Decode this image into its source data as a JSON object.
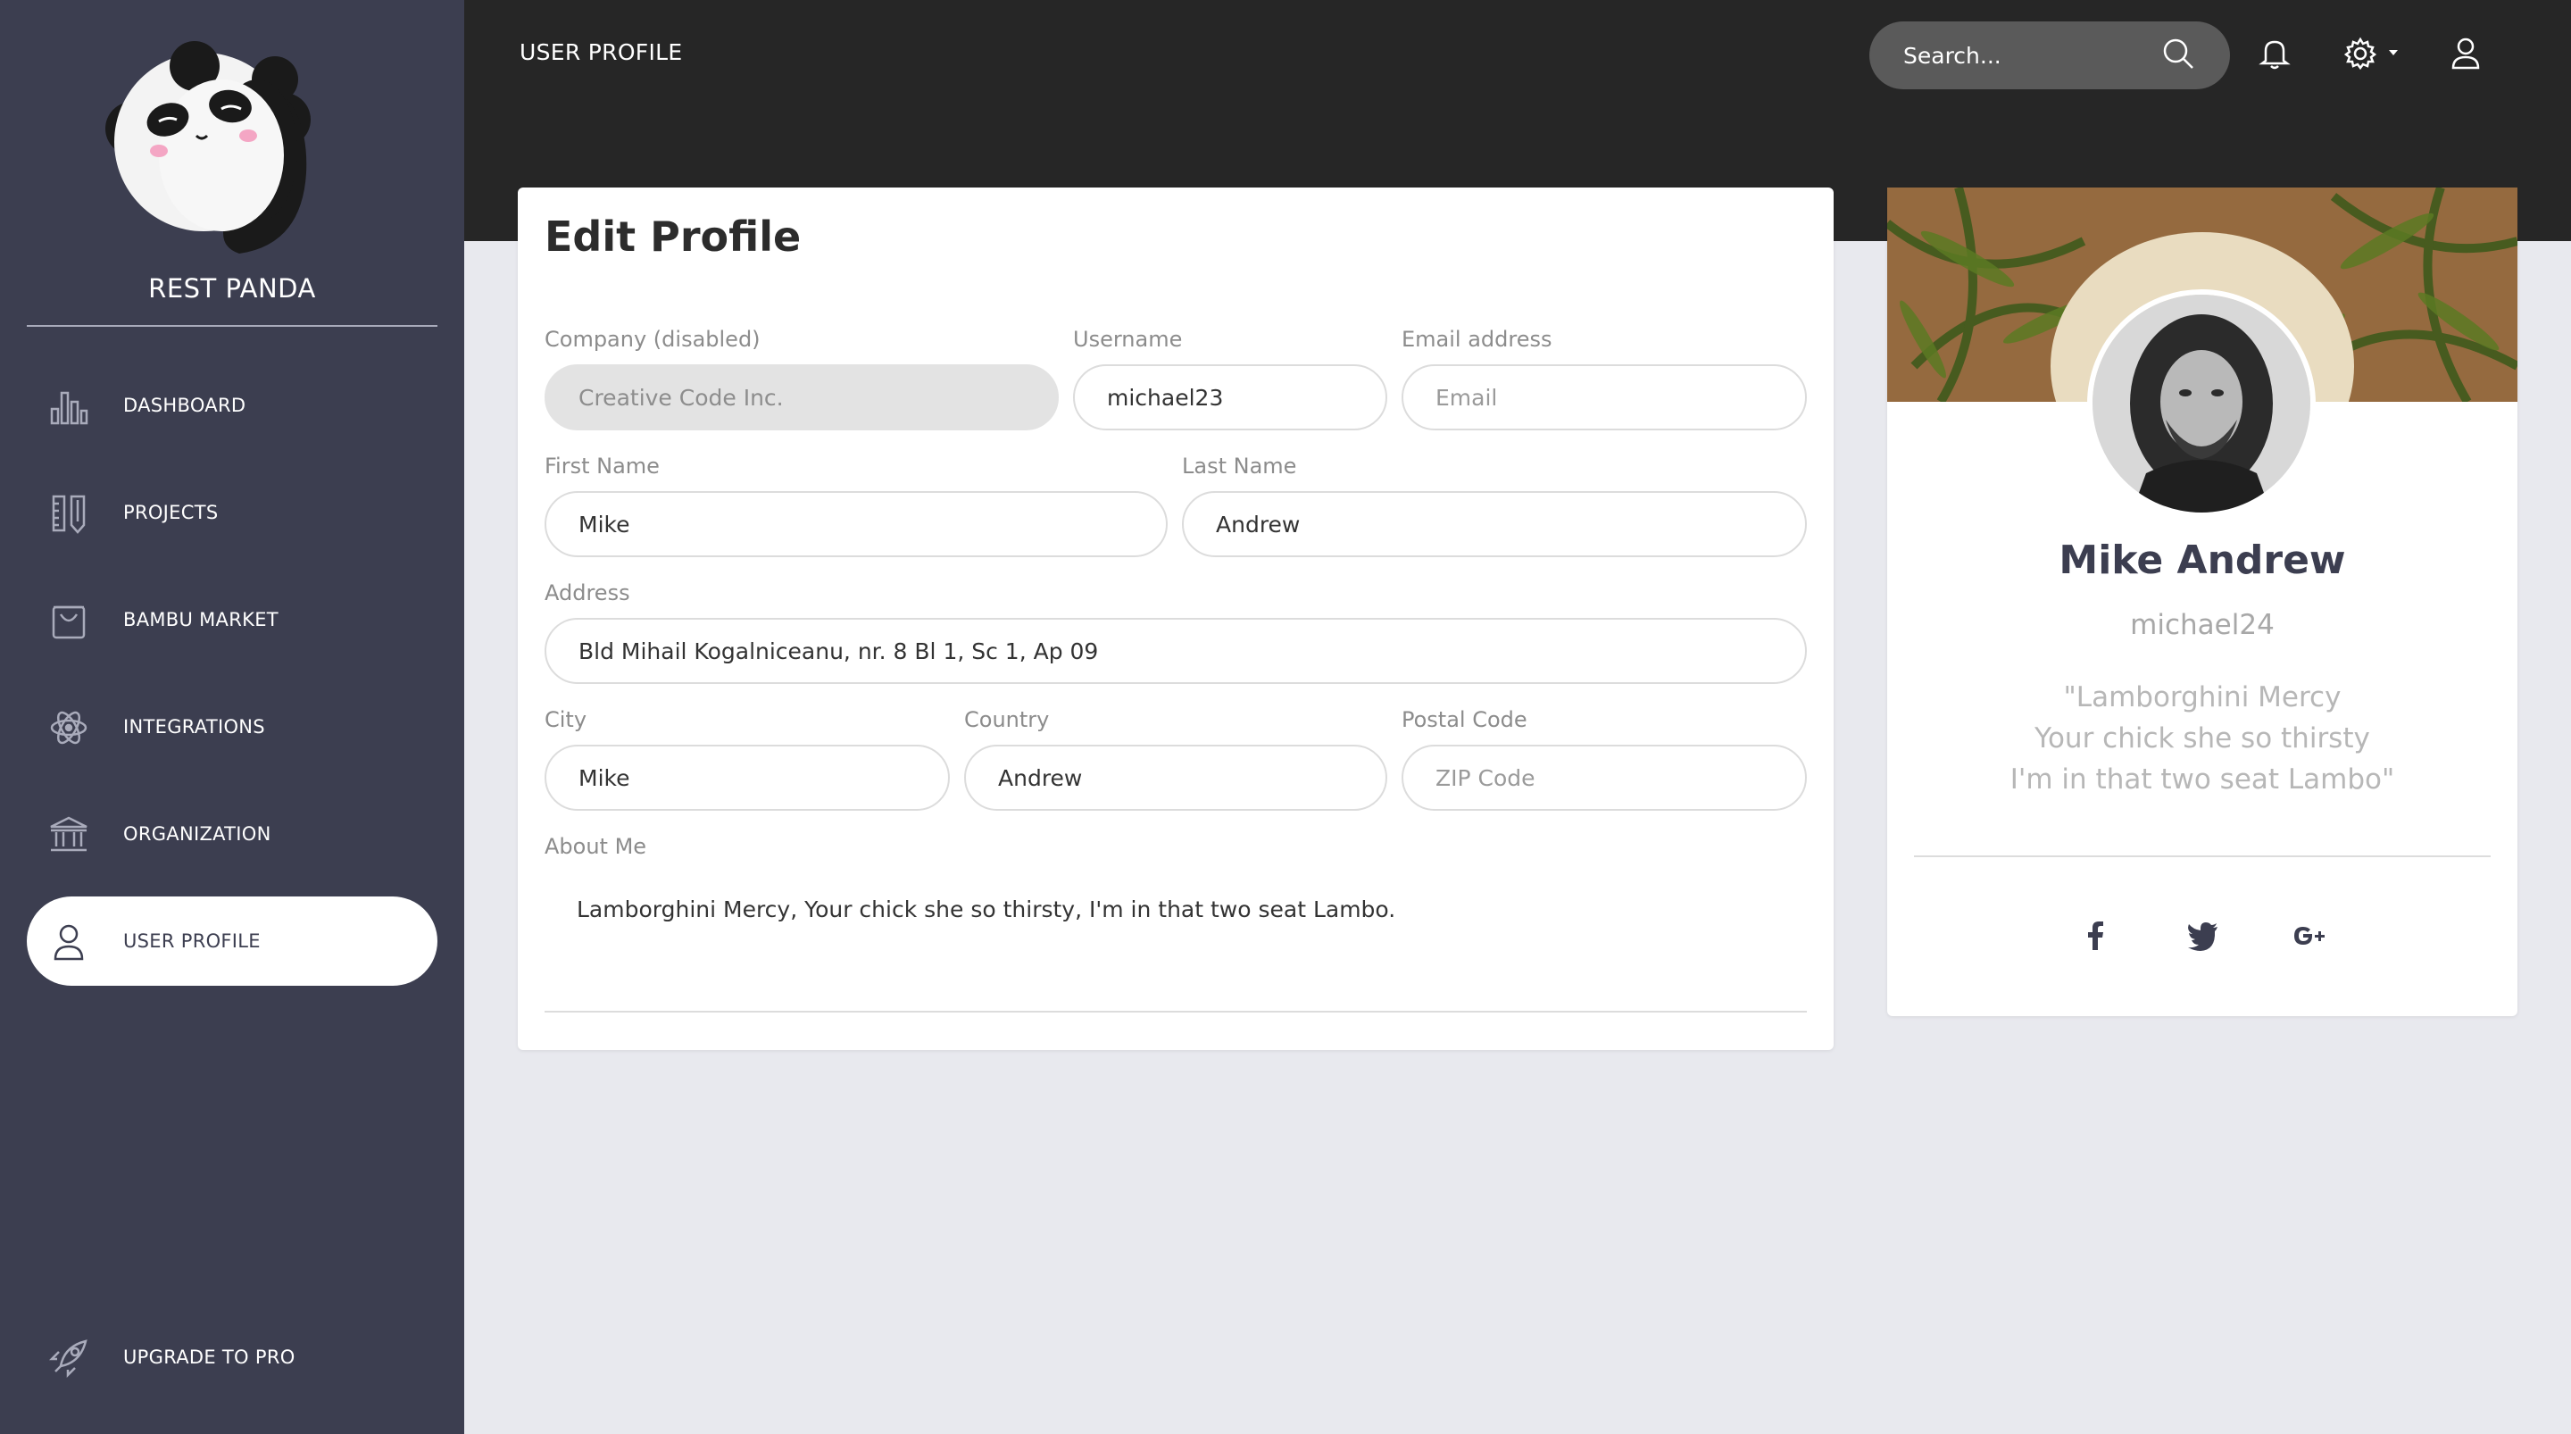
{
  "brand": {
    "name": "REST PANDA"
  },
  "sidebar": {
    "items": [
      {
        "label": "DASHBOARD",
        "icon": "bar-chart-icon"
      },
      {
        "label": "PROJECTS",
        "icon": "rulers-icon"
      },
      {
        "label": "BAMBU MARKET",
        "icon": "shopping-bag-icon"
      },
      {
        "label": "INTEGRATIONS",
        "icon": "atom-icon"
      },
      {
        "label": "ORGANIZATION",
        "icon": "building-icon"
      },
      {
        "label": "USER PROFILE",
        "icon": "user-icon",
        "active": true
      }
    ],
    "upgrade": {
      "label": "UPGRADE TO PRO",
      "icon": "rocket-icon"
    }
  },
  "header": {
    "title": "USER PROFILE",
    "search_placeholder": "Search..."
  },
  "edit_profile": {
    "title": "Edit Profile",
    "company": {
      "label": "Company (disabled)",
      "value": "Creative Code Inc."
    },
    "username": {
      "label": "Username",
      "value": "michael23"
    },
    "email": {
      "label": "Email address",
      "placeholder": "Email"
    },
    "first_name": {
      "label": "First Name",
      "value": "Mike"
    },
    "last_name": {
      "label": "Last Name",
      "value": "Andrew"
    },
    "address": {
      "label": "Address",
      "value": "Bld Mihail Kogalniceanu, nr. 8 Bl 1, Sc 1, Ap 09"
    },
    "city": {
      "label": "City",
      "value": "Mike"
    },
    "country": {
      "label": "Country",
      "value": "Andrew"
    },
    "postal": {
      "label": "Postal Code",
      "placeholder": "ZIP Code"
    },
    "about": {
      "label": "About Me",
      "value": "Lamborghini Mercy, Your chick she so thirsty, I'm in that two seat Lambo."
    }
  },
  "profile_card": {
    "name": "Mike Andrew",
    "username": "michael24",
    "quote_lines": [
      "\"Lamborghini Mercy",
      "Your chick she so thirsty",
      "I'm in that two seat Lambo\""
    ],
    "social": [
      "facebook-icon",
      "twitter-icon",
      "google-plus-icon"
    ]
  },
  "colors": {
    "sidebar": "#3c3e50",
    "header": "#262626",
    "background": "#e8e9ee",
    "name": "#3c3e50"
  }
}
